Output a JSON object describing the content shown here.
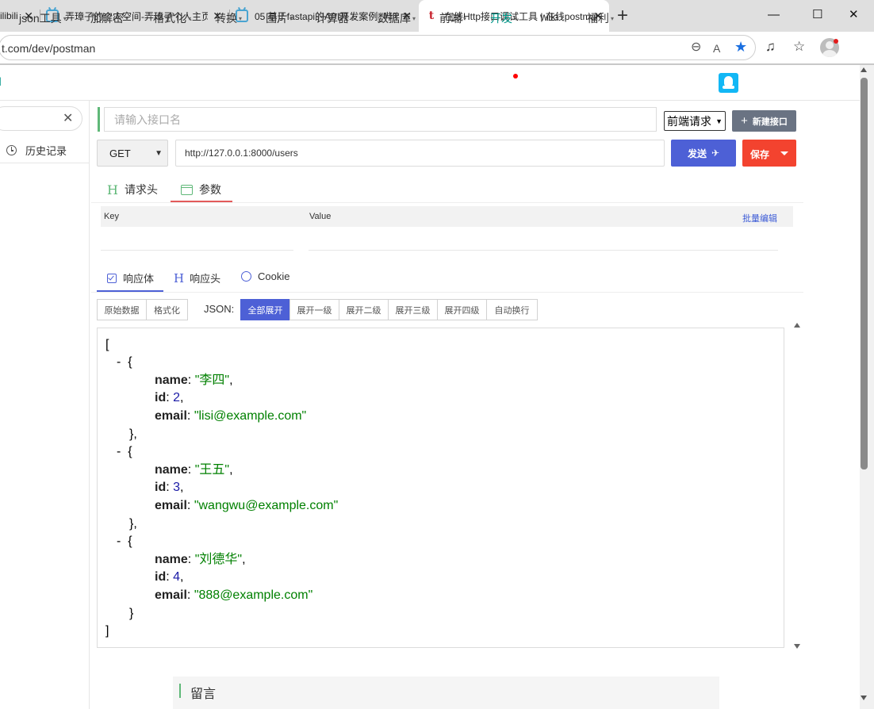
{
  "browser": {
    "tabs": [
      {
        "title": "ilibili",
        "close": "✕"
      },
      {
        "title": "弄璋子的个人空间-弄璋子个人主页",
        "close": "✕"
      },
      {
        "title": "05 基于fastapi的API开发案例_哔哩",
        "close": "✕"
      },
      {
        "title": "在线Http接口调试工具 | 在线postman",
        "close": "✕"
      }
    ],
    "new_tab": "+",
    "window_controls": {
      "minimize": "—",
      "maximize": "☐",
      "close": "✕"
    },
    "address": "t.com/dev/postman",
    "icons": [
      "zoom-icon",
      "read-aloud-icon",
      "favorite-star-icon",
      "music-icon",
      "favorites-icon",
      "profile-avatar"
    ],
    "accent": "#1a6fe0"
  },
  "site_nav": {
    "items": [
      {
        "label": "json工具",
        "caret": "▾"
      },
      {
        "label": "加解密",
        "caret": "▾"
      },
      {
        "label": "格式化",
        "caret": "▾"
      },
      {
        "label": "转换",
        "caret": "▾"
      },
      {
        "label": "图片",
        "caret": "▾"
      },
      {
        "label": "计算器",
        "caret": "▾"
      },
      {
        "label": "数据库",
        "caret": "▾"
      },
      {
        "label": "前端",
        "caret": "▾"
      },
      {
        "label": "开发",
        "caret": "▾"
      },
      {
        "label": "wiki",
        "caret": "▾"
      },
      {
        "label": "福利",
        "caret": "▾"
      }
    ],
    "active_color": "#009688"
  },
  "sidebar": {
    "search_clear": "✕",
    "history_label": "历史记录"
  },
  "request": {
    "name_placeholder": "请输入接口名",
    "type_select": "前端请求",
    "new_button": "新建接口",
    "new_plus": "+",
    "method": "GET",
    "method_arrow": "⌄",
    "url": "http://127.0.0.1:8000/users",
    "send_button": "发送",
    "send_icon": "✈",
    "save_button": "保存",
    "tabs": [
      {
        "label": "请求头",
        "icon": "H"
      },
      {
        "label": "参数"
      }
    ],
    "params_table": {
      "key_header": "Key",
      "value_header": "Value",
      "batch_edit": "批量编辑"
    }
  },
  "response": {
    "tabs": [
      {
        "label": "响应体"
      },
      {
        "label": "响应头",
        "icon": "H"
      },
      {
        "label": "Cookie"
      }
    ],
    "view_buttons": [
      "原始数据",
      "格式化"
    ],
    "json_label": "JSON:",
    "expand_buttons": [
      "全部展开",
      "展开一级",
      "展开二级",
      "展开三级",
      "展开四级",
      "自动换行"
    ],
    "json": {
      "open": "[",
      "close": "]",
      "collapse": "-",
      "obj_open": "{",
      "obj_close": "},",
      "last_close": "}",
      "items": [
        {
          "name": "\"李四\"",
          "id": "2",
          "email": "\"lisi@example.com\""
        },
        {
          "name": "\"王五\"",
          "id": "3",
          "email": "\"wangwu@example.com\""
        },
        {
          "name": "\"刘德华\"",
          "id": "4",
          "email": "\"888@example.com\""
        }
      ],
      "keys": {
        "name": "name",
        "id": "id",
        "email": "email"
      }
    }
  },
  "comments": {
    "title": "留言"
  },
  "colors": {
    "send": "#4d60d6",
    "save": "#f3432f",
    "new": "#6a7383",
    "json_string": "#008000",
    "json_number": "#1a1aa6"
  }
}
